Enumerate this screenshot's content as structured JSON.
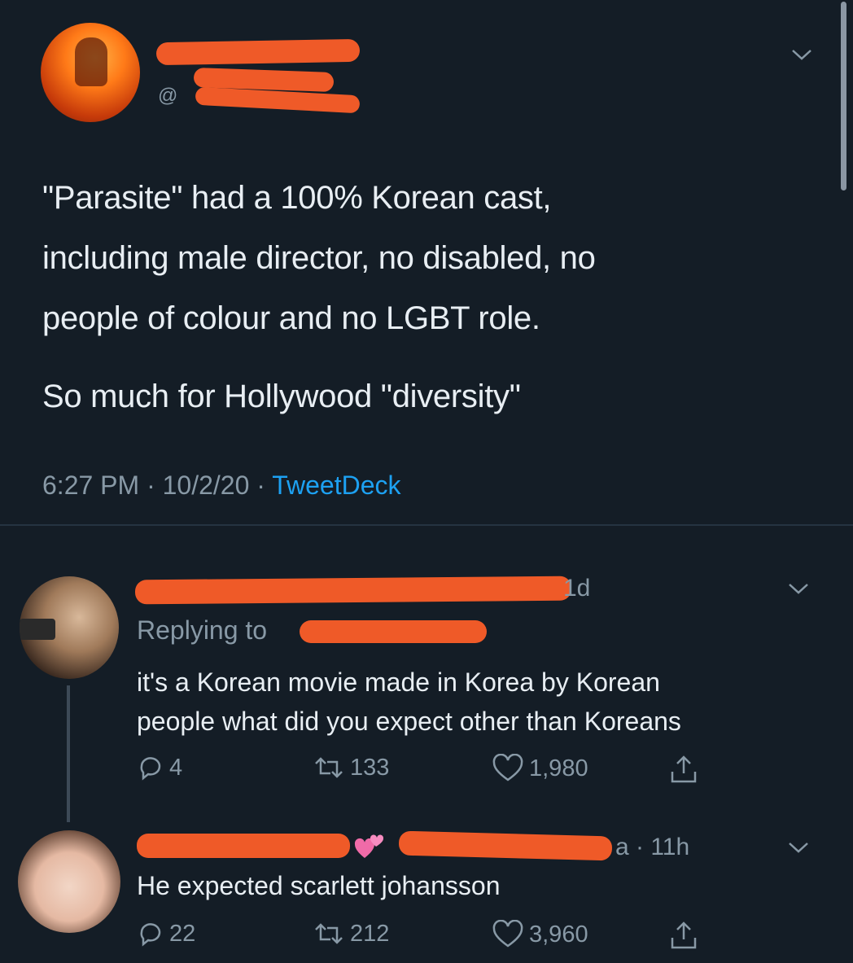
{
  "main_tweet": {
    "handle_prefix": "@",
    "text_lines": [
      "\"Parasite\" had a 100% Korean cast,",
      "including male director, no disabled, no",
      "people of colour and no LGBT role."
    ],
    "text_line_2": "So much for Hollywood \"diversity\"",
    "time": "6:27 PM",
    "date": "10/2/20",
    "source": "TweetDeck",
    "separator": "·"
  },
  "reply_1": {
    "time_suffix": "1d",
    "replying_to": "Replying to",
    "text_lines": [
      "it's a Korean movie made in Korea by Korean",
      "people what did you expect other than Koreans"
    ],
    "replies": "4",
    "retweets": "133",
    "likes": "1,980"
  },
  "reply_2": {
    "time_suffix": "a · 11h",
    "text": "He expected scarlett johansson",
    "replies": "22",
    "retweets": "212",
    "likes": "3,960"
  },
  "colors": {
    "background": "#141d26",
    "redaction": "#ef5a28",
    "link": "#1da1f2",
    "muted": "#8899a6"
  },
  "icons": [
    "chevron-down-icon",
    "reply-icon",
    "retweet-icon",
    "like-icon",
    "share-icon",
    "heart-emoji-icon"
  ]
}
